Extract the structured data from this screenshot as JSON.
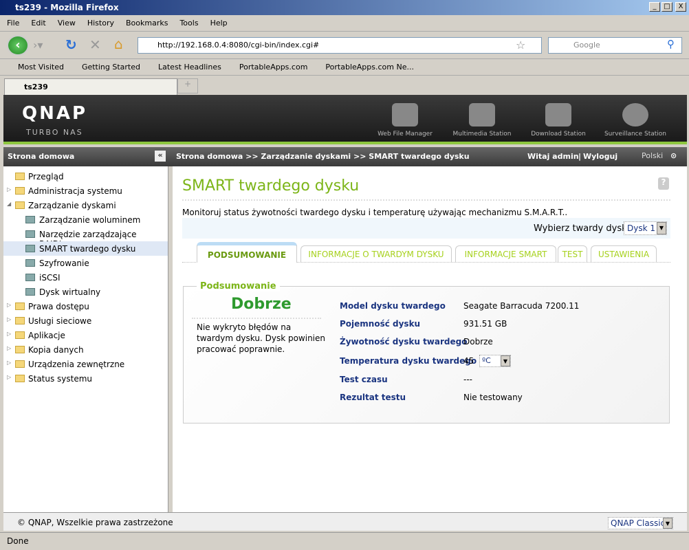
{
  "window": {
    "title": "ts239 - Mozilla Firefox"
  },
  "menu": [
    "File",
    "Edit",
    "View",
    "History",
    "Bookmarks",
    "Tools",
    "Help"
  ],
  "url": "http://192.168.0.4:8080/cgi-bin/index.cgi#",
  "search_placeholder": "Google",
  "bookmarks": [
    "Most Visited",
    "Getting Started",
    "Latest Headlines",
    "PortableApps.com",
    "PortableApps.com Ne..."
  ],
  "tab": "ts239",
  "header": {
    "logo": "QNAP",
    "subtitle": "Turbo NAS",
    "apps": [
      "Web File Manager",
      "Multimedia Station",
      "Download Station",
      "Surveillance Station"
    ]
  },
  "crumb": {
    "home": "Strona domowa",
    "path": "Strona domowa >> Zarządzanie dyskami >> SMART twardego dysku",
    "welcome": "Witaj admin",
    "logout": "Wyloguj",
    "lang": "Polski"
  },
  "sidebar": [
    {
      "label": "Przegląd",
      "level": 0,
      "icon": "overview"
    },
    {
      "label": "Administracja systemu",
      "level": 0,
      "icon": "folder",
      "arrow": "▷"
    },
    {
      "label": "Zarządzanie dyskami",
      "level": 0,
      "icon": "folder",
      "arrow": "◢"
    },
    {
      "label": "Zarządzanie woluminem",
      "level": 1
    },
    {
      "label": "Narzędzie zarządzające RAID'em",
      "level": 1
    },
    {
      "label": "SMART twardego dysku",
      "level": 1,
      "selected": true
    },
    {
      "label": "Szyfrowanie",
      "level": 1
    },
    {
      "label": "iSCSI",
      "level": 1
    },
    {
      "label": "Dysk wirtualny",
      "level": 1
    },
    {
      "label": "Prawa dostępu",
      "level": 0,
      "icon": "folder",
      "arrow": "▷"
    },
    {
      "label": "Usługi sieciowe",
      "level": 0,
      "icon": "folder",
      "arrow": "▷"
    },
    {
      "label": "Aplikacje",
      "level": 0,
      "icon": "folder",
      "arrow": "▷"
    },
    {
      "label": "Kopia danych",
      "level": 0,
      "icon": "folder",
      "arrow": "▷"
    },
    {
      "label": "Urządzenia zewnętrzne",
      "level": 0,
      "icon": "folder",
      "arrow": "▷"
    },
    {
      "label": "Status systemu",
      "level": 0,
      "icon": "folder",
      "arrow": "▷"
    }
  ],
  "main": {
    "title": "SMART twardego dysku",
    "desc": "Monitoruj status żywotności twardego dysku i temperaturę używając mechanizmu S.M.A.R.T..",
    "disk_label": "Wybierz twardy dysk",
    "disk_value": "Dysk 1",
    "tabs": [
      "PODSUMOWANIE",
      "INFORMACJE O TWARDYM DYSKU",
      "INFORMACJE SMART",
      "TEST",
      "USTAWIENIA"
    ],
    "legend": "Podsumowanie",
    "status": "Dobrze",
    "status_desc": "Nie wykryto błędów na twardym dysku. Dysk powinien pracować poprawnie.",
    "rows": [
      {
        "label": "Model dysku twardego",
        "value": "Seagate Barracuda 7200.11"
      },
      {
        "label": "Pojemność dysku",
        "value": "931.51 GB"
      },
      {
        "label": "Żywotność dysku twardego",
        "value": "Dobrze"
      },
      {
        "label": "Temperatura dysku twardego",
        "value": "45"
      },
      {
        "label": "Test czasu",
        "value": "---"
      },
      {
        "label": "Rezultat testu",
        "value": "Nie testowany"
      }
    ],
    "temp_unit": "ºC"
  },
  "footer": {
    "copyright": "© QNAP, Wszelkie prawa zastrzeżone",
    "theme": "QNAP Classic"
  },
  "statusbar": "Done",
  "colors": {
    "accent": "#8dc63f",
    "label": "#1a3480",
    "status": "#2e9a2e"
  }
}
